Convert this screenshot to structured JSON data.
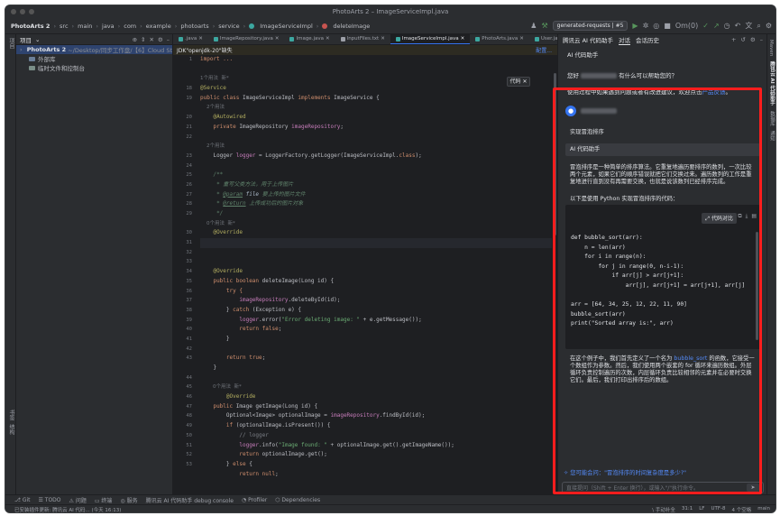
{
  "window": {
    "title": "PhotoArts 2 – ImageServiceImpl.java"
  },
  "navbar": {
    "breadcrumbs": [
      "PhotoArts 2",
      "src",
      "main",
      "java",
      "com",
      "example",
      "photoarts",
      "service",
      "ImageServiceImpl",
      "deleteImage"
    ],
    "run_config": "generated-requests | #5",
    "om_label": "Om(0)"
  },
  "project": {
    "header": "项目",
    "root_name": "PhotoArts 2",
    "root_path": "~/Desktop/同步工作盘/【6】Cloud St",
    "items": [
      "外部库",
      "临时文件和控制台"
    ]
  },
  "tabs": [
    ".java",
    "ImageRepository.java",
    "Image.java",
    "InputFiles.txt",
    "ImageServiceImpl.java",
    "PhotoArts.java",
    "User.java"
  ],
  "notice": {
    "text": "JDK\"openjdk-20\"缺失",
    "action": "配置..."
  },
  "line_numbers": [
    "1",
    "",
    "18",
    "19",
    "20",
    "21",
    "22",
    "23",
    "24",
    "25",
    "26",
    "27",
    "28",
    "29",
    "30",
    "31",
    "32",
    "33",
    "34",
    "35",
    "36",
    "37",
    "38",
    "39",
    "40",
    "41",
    "42",
    "43",
    "44",
    "45",
    "46",
    "47",
    "48",
    "49",
    "50",
    "51",
    "52",
    "53"
  ],
  "code": {
    "l1": "import ...",
    "usage1": "1个用法  新*",
    "l18": "@Service",
    "l19a": "public class ",
    "l19b": "ImageServiceImpl ",
    "l19c": "implements ",
    "l19d": "ImageService {",
    "usage2": "2个用法",
    "l20": "@Autowired",
    "l21a": "private ",
    "l21b": "ImageRepository ",
    "l21c": "imageRepository",
    "l21d": ";",
    "usage3": "2个用法",
    "l23a": "Logger ",
    "l23b": "logger",
    "l23c": " = LoggerFactory.getLogger(ImageServiceImpl.",
    "l23d": "class",
    "l23e": ");",
    "l25": "/**",
    "l26": " * 重写父类方法，用于上传图片",
    "l27a": " * ",
    "l27b": "@param",
    "l27c": " file",
    "l27d": " 要上传的图片文件",
    "l28a": " * ",
    "l28b": "@return",
    "l28c": " 上传成功后的图片对象",
    "l29": " */",
    "usage4": "0个用法  新*",
    "l30": "@Override",
    "l33": "@Override",
    "l34a": "public boolean ",
    "l34b": "deleteImage(Long id) {",
    "l35": "try {",
    "l36a": "imageRepository",
    "l36b": ".deleteById(id);",
    "l37a": "} ",
    "l37b": "catch ",
    "l37c": "(Exception e) {",
    "l38a": "logger",
    "l38b": ".error(",
    "l38c": "\"Error deleting image: \"",
    "l38d": " + e.getMessage());",
    "l39a": "return ",
    "l39b": "false",
    "l39c": ";",
    "l40": "}",
    "l42a": "return ",
    "l42b": "true",
    "l42c": ";",
    "l43": "}",
    "usage5": "0个用法  新*",
    "l45": "@Override",
    "l46a": "public ",
    "l46b": "Image getImage(Long id) {",
    "l47a": "Optional<Image> optionalImage = ",
    "l47b": "imageRepository",
    "l47c": ".findById(id);",
    "l48a": "if ",
    "l48b": "(optionalImage.isPresent()) {",
    "l49": "// logger",
    "l50a": "logger",
    "l50b": ".info(",
    "l50c": "\"Image found: \"",
    "l50d": " + optionalImage.get().getImageName());",
    "l51a": "return ",
    "l51b": "optionalImage.get();",
    "l52a": "} ",
    "l52b": "else ",
    "l52c": "{",
    "l53a": "return ",
    "l53b": "null",
    "l53c": ";"
  },
  "popup": "代码",
  "ai": {
    "title": "AI 代码助手",
    "panel_name": "腾讯云 AI 代码助手",
    "tab_chat": "对话",
    "tab_history": "会话历史",
    "greeting_pre": "您好",
    "greeting_post": "有什么可以帮助您的？",
    "tip_pre": "使用过程中如果遇到问题或者有改进建议，欢迎点击",
    "tip_link": "产品反馈",
    "tip_post": "。",
    "user_prompt": "实现冒泡排序",
    "assistant_name": "AI 代码助手",
    "intro": "冒泡排序是一种简单的排序算法。它重复地遍历要排序的数列，一次比较两个元素，如果它们的顺序错误就把它们交换过来。遍历数列的工作是重复地进行直到没有再需要交换，也就是说该数列已经排序完成。",
    "code_intro": "以下是使用 Python 实现冒泡排序的代码：",
    "compare_btn": "代码对比",
    "python_code": "def bubble_sort(arr):\n    n = len(arr)\n    for i in range(n):\n        for j in range(0, n-i-1):\n            if arr[j] > arr[j+1]:\n                arr[j], arr[j+1] = arr[j+1], arr[j]\n\narr = [64, 34, 25, 12, 22, 11, 90]\nbubble_sort(arr)\nprint(\"Sorted array is:\", arr)",
    "explanation_pre": "在这个例子中，我们首先定义了一个名为 ",
    "explanation_fn": "bubble_sort",
    "explanation_post": " 的函数，它接受一个数组作为参数。然后，我们使用两个嵌套的 for 循环来遍历数组。外层循环负责控制遍历的次数，内层循环负责比较相邻的元素并在必要时交换它们。最后，我们打印出排序后的数组。",
    "suggestion": "您可能会问：\"冒泡排序的时间复杂度是多少?\"",
    "input_placeholder": "直接提问（Shift + Enter 换行），或输入\"/\"执行命令。"
  },
  "right_stripe": [
    "Maven",
    "腾讯云 AI 代码助手",
    "数据库",
    "通知"
  ],
  "left_stripe": [
    "项目",
    "书签",
    "结构"
  ],
  "toolstrip": [
    "Git",
    "TODO",
    "问题",
    "终端",
    "服务",
    "腾讯云 AI 代码助手 debug console",
    "Profiler",
    "Dependencies"
  ],
  "statusbar": {
    "left": "已安装插件更新: 腾讯云 AI 代码... (今天 16:13)",
    "right": [
      "\\ 手动补全",
      "31:1",
      "LF",
      "UTF-8",
      "4 个空格",
      "main"
    ]
  }
}
